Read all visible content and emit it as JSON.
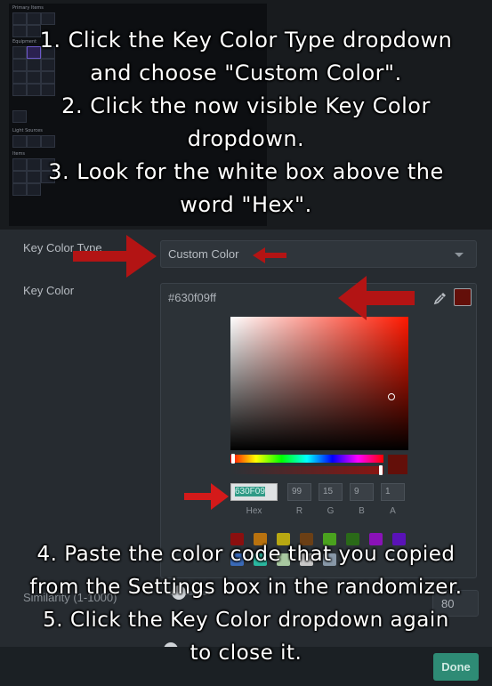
{
  "thumbnail": {
    "labels": [
      "Primary Items",
      "Equipment",
      "Light Sources",
      "Items"
    ]
  },
  "instructions_top": [
    "1. Click the Key Color Type dropdown",
    "and choose \"Custom Color\".",
    "2. Click the now visible Key Color",
    "dropdown.",
    "3. Look for the white box above the",
    "word \"Hex\"."
  ],
  "instructions_bottom": [
    "4. Paste the color code that you copied",
    "from the Settings box in the randomizer.",
    "5. Click the Key Color dropdown again",
    "to close it."
  ],
  "form": {
    "key_color_type_label": "Key Color Type",
    "key_color_type_value": "Custom Color",
    "key_color_label": "Key Color",
    "similarity_label": "Similarity (1-1000)",
    "similarity_value": "80"
  },
  "picker": {
    "hex_header": "#630f09ff",
    "hex_input": "630F09",
    "r": "99",
    "g": "15",
    "b": "9",
    "a": "1",
    "labels": {
      "hex": "Hex",
      "r": "R",
      "g": "G",
      "b": "B",
      "a": "A"
    },
    "current_color": "#630f09"
  },
  "palette_colors": [
    "#8b0f0f",
    "#b8720f",
    "#b8a812",
    "#6b3f15",
    "#4aa21e",
    "#2a6a18",
    "#8a12b8",
    "#5a12b8"
  ],
  "palette_colors_row2": [
    "#3a6ab8",
    "#2ab8a0",
    "#a8c8a0",
    "#c8c8c8",
    "#8898a8"
  ],
  "footer": {
    "done_label": "Done"
  },
  "colors": {
    "arrow": "#b31414",
    "done": "#2e8b75"
  }
}
